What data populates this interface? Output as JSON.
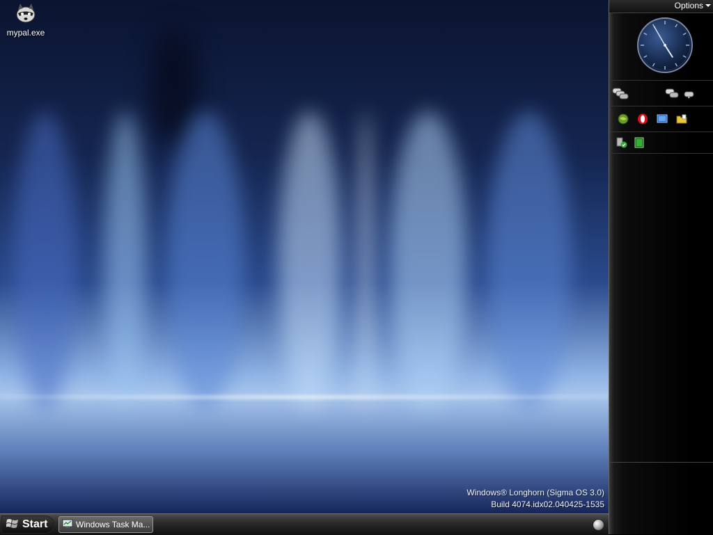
{
  "desktop": {
    "icons": [
      {
        "label": "mypal.exe",
        "icon": "raccoon-icon"
      }
    ],
    "watermark": {
      "line1": "Windows® Longhorn (Sigma OS 3.0)",
      "line2": "Build 4074.idx02.040425-1535"
    }
  },
  "sidebar": {
    "options_label": "Options",
    "clock": {
      "hour": 4,
      "minute": 55,
      "second": 55
    },
    "chat_icons": [
      "chat-bubbles-icon",
      "chat-bubbles-icon",
      "chat-bubble-icon"
    ],
    "launch_icons": [
      "globe-icon",
      "opera-icon",
      "monitor-icon",
      "folder-icon"
    ],
    "tray_icons": [
      "security-shield-icon",
      "green-square-icon"
    ]
  },
  "taskbar": {
    "start_label": "Start",
    "task_button_label": "Windows Task Ma...",
    "task_button_icon": "task-manager-icon",
    "tray_orb_icon": "orb-icon"
  }
}
